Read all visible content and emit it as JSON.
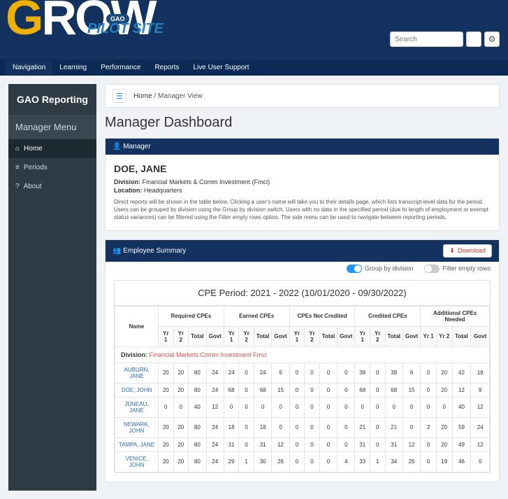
{
  "banner": {
    "logo_g": "G",
    "logo_rest": "ROW",
    "gao": "GAO",
    "pilot": "PILOT SITE",
    "search_ph": "Search"
  },
  "nav": [
    "Navigation",
    "Learning",
    "Performance",
    "Reports",
    "Live User Support"
  ],
  "sidebar": {
    "title": "GAO Reporting",
    "menu": "Manager Menu",
    "items": [
      {
        "icon": "⌂",
        "label": "Home"
      },
      {
        "icon": "≡",
        "label": "Periods"
      },
      {
        "icon": "?",
        "label": "About"
      }
    ]
  },
  "crumb": {
    "home": "Home",
    "sep": "/",
    "cur": "Manager View"
  },
  "page_title": "Manager Dashboard",
  "mgr_panel": {
    "title": "Manager",
    "name": "DOE, JANE",
    "div_l": "Division:",
    "div_v": "Financial Markets & Comm Investment (Fmci)",
    "loc_l": "Location:",
    "loc_v": "Headquarters",
    "help": "Direct reports will be shown in the table below. Clicking a user's name will take you to their details page, which lists transcript-level data for the period. Users can be grouped by division using the Group by division switch. Users with no data in the specified period (due to length of employment or exempt status variances) can be filtered using the Filter empty rows option. The side menu can be used to navigate between reporting periods."
  },
  "emp_panel": {
    "title": "Employee Summary",
    "download": "Download",
    "tog1": "Group by division",
    "tog2": "Filter empty rows"
  },
  "table": {
    "period": "CPE Period: 2021 - 2022     (10/01/2020 - 09/30/2022)",
    "name": "Name",
    "groups": [
      "Required CPEs",
      "Earned CPEs",
      "CPEs Not Credited",
      "Credited CPEs",
      "Additional CPEs Needed"
    ],
    "subs": [
      "Yr 1",
      "Yr 2",
      "Total",
      "Govt"
    ],
    "div_l": "Division:",
    "div_v": "Financial Markets Comm Investment Fmci",
    "rows": [
      {
        "n": "AUBURN, JANE",
        "v": [
          20,
          20,
          80,
          24,
          24,
          0,
          24,
          6,
          0,
          0,
          0,
          0,
          38,
          0,
          38,
          6,
          0,
          20,
          42,
          18
        ]
      },
      {
        "n": "DOE, JOHN",
        "v": [
          20,
          20,
          80,
          24,
          68,
          0,
          68,
          15,
          0,
          0,
          0,
          0,
          68,
          0,
          68,
          15,
          0,
          20,
          12,
          9
        ]
      },
      {
        "n": "JUNEAU, JANE",
        "v": [
          0,
          0,
          40,
          12,
          0,
          0,
          0,
          0,
          0,
          0,
          0,
          0,
          0,
          0,
          0,
          0,
          0,
          0,
          40,
          12
        ]
      },
      {
        "n": "NEWARK, JOHN",
        "v": [
          20,
          20,
          80,
          24,
          18,
          0,
          18,
          0,
          0,
          0,
          0,
          0,
          21,
          0,
          21,
          0,
          2,
          20,
          59,
          24
        ]
      },
      {
        "n": "TAMPA, JANE",
        "v": [
          20,
          20,
          80,
          24,
          31,
          0,
          31,
          12,
          0,
          0,
          0,
          0,
          31,
          0,
          31,
          12,
          0,
          20,
          49,
          12
        ]
      },
      {
        "n": "VENICE, JOHN",
        "v": [
          20,
          20,
          80,
          24,
          29,
          1,
          30,
          26,
          0,
          0,
          0,
          4,
          33,
          1,
          34,
          26,
          0,
          19,
          46,
          0
        ]
      }
    ]
  }
}
